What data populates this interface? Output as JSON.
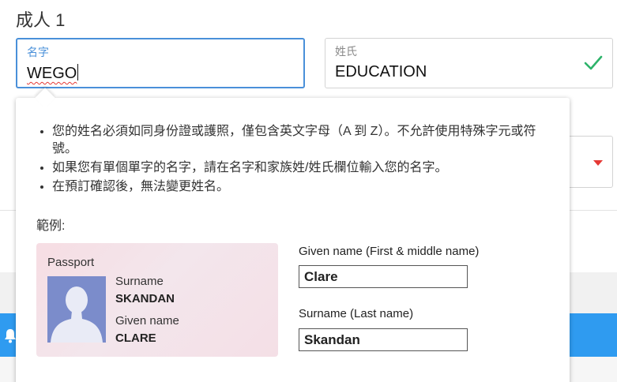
{
  "section": {
    "title": "成人 1"
  },
  "first_name": {
    "label": "名字",
    "value": "WEGO"
  },
  "last_name": {
    "label": "姓氏",
    "value": "EDUCATION",
    "valid": true
  },
  "popup": {
    "rules": [
      "您的姓名必須如同身份證或護照，僅包含英文字母（A 到 Z）。不允許使用特殊字元或符號。",
      "如果您有單個單字的名字，請在名字和家族姓/姓氏欄位輸入您的名字。",
      "在預訂確認後，無法變更姓名。"
    ],
    "example_label": "範例:",
    "passport": {
      "title": "Passport",
      "surname_label": "Surname",
      "surname_value": "SKANDAN",
      "given_label": "Given name",
      "given_value": "CLARE"
    },
    "given_field": {
      "label": "Given name (First & middle name)",
      "value": "Clare"
    },
    "surname_field": {
      "label": "Surname (Last name)",
      "value": "Skandan"
    }
  },
  "colors": {
    "focus_border": "#4a90d9",
    "valid_check": "#2db36a",
    "dropdown_arrow": "#e53935",
    "blue_bar": "#2f9bf0",
    "passport_photo": "#7b8ccb"
  },
  "icons": {
    "valid": "check-icon",
    "dropdown": "dropdown-arrow-icon",
    "notification": "bell-icon",
    "avatar": "silhouette-icon"
  }
}
